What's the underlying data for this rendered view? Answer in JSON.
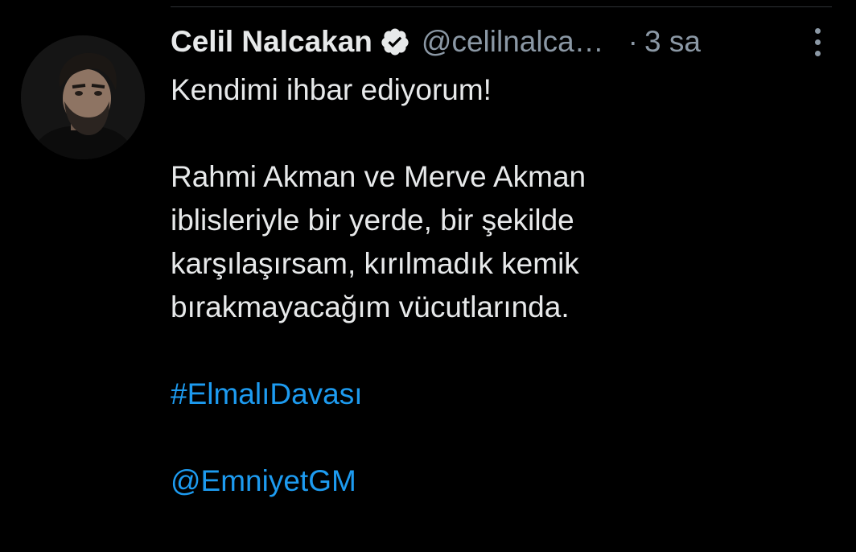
{
  "tweet": {
    "author_name": "Celil Nalcakan",
    "handle": "@celilnalca…",
    "separator": "·",
    "time": "3 sa",
    "lines": [
      "Kendimi ihbar ediyorum!",
      "Rahmi Akman ve Merve Akman",
      "iblisleriyle bir yerde, bir şekilde",
      "karşılaşırsam, kırılmadık kemik",
      "bırakmayacağım vücutlarında."
    ],
    "hashtag": "#ElmalıDavası",
    "mention": "@EmniyetGM"
  },
  "colors": {
    "background": "#000000",
    "text": "#e7e9ea",
    "secondary": "#8b98a5",
    "link": "#1d9bf0",
    "verified_badge": "#e7e9ea"
  },
  "icons": {
    "verified": "verified-badge-icon",
    "more": "more-vertical-icon"
  }
}
